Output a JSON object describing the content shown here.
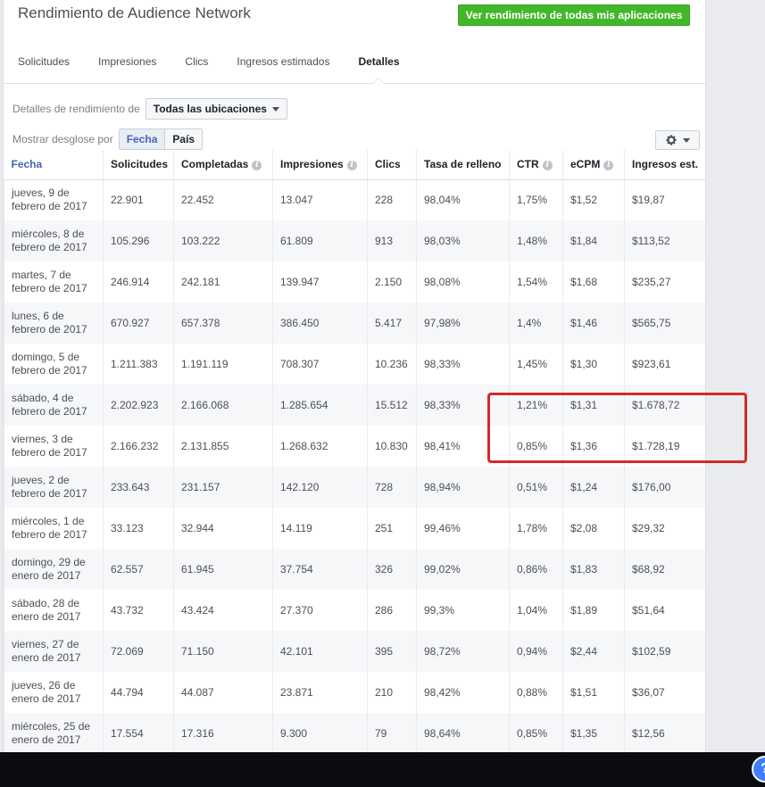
{
  "header": {
    "title": "Rendimiento de Audience Network",
    "all_apps_button": "Ver rendimiento de todas mis aplicaciones"
  },
  "tabs": [
    {
      "label": "Solicitudes"
    },
    {
      "label": "Impresiones"
    },
    {
      "label": "Clics"
    },
    {
      "label": "Ingresos estimados"
    },
    {
      "label": "Detalles"
    }
  ],
  "filters": {
    "detail_label": "Detalles de rendimiento de",
    "placement_value": "Todas las ubicaciones",
    "breakdown_label": "Mostrar desglose por",
    "breakdown_options": [
      "Fecha",
      "País"
    ],
    "breakdown_selected": "Fecha"
  },
  "table": {
    "headers": [
      "Fecha",
      "Solicitudes",
      "Completadas",
      "Impresiones",
      "Clics",
      "Tasa de relleno",
      "CTR",
      "eCPM",
      "Ingresos est."
    ],
    "rows": [
      {
        "date": "jueves, 9 de febrero de 2017",
        "solicitudes": "22.901",
        "completadas": "22.452",
        "impresiones": "13.047",
        "clics": "228",
        "tasa": "98,04%",
        "ctr": "1,75%",
        "ecpm": "$1,52",
        "ingresos": "$19,87"
      },
      {
        "date": "miércoles, 8 de febrero de 2017",
        "solicitudes": "105.296",
        "completadas": "103.222",
        "impresiones": "61.809",
        "clics": "913",
        "tasa": "98,03%",
        "ctr": "1,48%",
        "ecpm": "$1,84",
        "ingresos": "$113,52"
      },
      {
        "date": "martes, 7 de febrero de 2017",
        "solicitudes": "246.914",
        "completadas": "242.181",
        "impresiones": "139.947",
        "clics": "2.150",
        "tasa": "98,08%",
        "ctr": "1,54%",
        "ecpm": "$1,68",
        "ingresos": "$235,27"
      },
      {
        "date": "lunes, 6 de febrero de 2017",
        "solicitudes": "670.927",
        "completadas": "657.378",
        "impresiones": "386.450",
        "clics": "5.417",
        "tasa": "97,98%",
        "ctr": "1,4%",
        "ecpm": "$1,46",
        "ingresos": "$565,75"
      },
      {
        "date": "domingo, 5 de febrero de 2017",
        "solicitudes": "1.211.383",
        "completadas": "1.191.119",
        "impresiones": "708.307",
        "clics": "10.236",
        "tasa": "98,33%",
        "ctr": "1,45%",
        "ecpm": "$1,30",
        "ingresos": "$923,61"
      },
      {
        "date": "sábado, 4 de febrero de 2017",
        "solicitudes": "2.202.923",
        "completadas": "2.166.068",
        "impresiones": "1.285.654",
        "clics": "15.512",
        "tasa": "98,33%",
        "ctr": "1,21%",
        "ecpm": "$1,31",
        "ingresos": "$1.678,72"
      },
      {
        "date": "viernes, 3 de febrero de 2017",
        "solicitudes": "2.166.232",
        "completadas": "2.131.855",
        "impresiones": "1.268.632",
        "clics": "10.830",
        "tasa": "98,41%",
        "ctr": "0,85%",
        "ecpm": "$1,36",
        "ingresos": "$1.728,19"
      },
      {
        "date": "jueves, 2 de febrero de 2017",
        "solicitudes": "233.643",
        "completadas": "231.157",
        "impresiones": "142.120",
        "clics": "728",
        "tasa": "98,94%",
        "ctr": "0,51%",
        "ecpm": "$1,24",
        "ingresos": "$176,00"
      },
      {
        "date": "miércoles, 1 de febrero de 2017",
        "solicitudes": "33.123",
        "completadas": "32.944",
        "impresiones": "14.119",
        "clics": "251",
        "tasa": "99,46%",
        "ctr": "1,78%",
        "ecpm": "$2,08",
        "ingresos": "$29,32"
      },
      {
        "date": "domingo, 29 de enero de 2017",
        "solicitudes": "62.557",
        "completadas": "61.945",
        "impresiones": "37.754",
        "clics": "326",
        "tasa": "99,02%",
        "ctr": "0,86%",
        "ecpm": "$1,83",
        "ingresos": "$68,92"
      },
      {
        "date": "sábado, 28 de enero de 2017",
        "solicitudes": "43.732",
        "completadas": "43.424",
        "impresiones": "27.370",
        "clics": "286",
        "tasa": "99,3%",
        "ctr": "1,04%",
        "ecpm": "$1,89",
        "ingresos": "$51,64"
      },
      {
        "date": "viernes, 27 de enero de 2017",
        "solicitudes": "72.069",
        "completadas": "71.150",
        "impresiones": "42.101",
        "clics": "395",
        "tasa": "98,72%",
        "ctr": "0,94%",
        "ecpm": "$2,44",
        "ingresos": "$102,59"
      },
      {
        "date": "jueves, 26 de enero de 2017",
        "solicitudes": "44.794",
        "completadas": "44.087",
        "impresiones": "23.871",
        "clics": "210",
        "tasa": "98,42%",
        "ctr": "0,88%",
        "ecpm": "$1,51",
        "ingresos": "$36,07"
      },
      {
        "date": "miércoles, 25 de enero de 2017",
        "solicitudes": "17.554",
        "completadas": "17.316",
        "impresiones": "9.300",
        "clics": "79",
        "tasa": "98,64%",
        "ctr": "0,85%",
        "ecpm": "$1,35",
        "ingresos": "$12,56"
      }
    ]
  },
  "icons": {
    "settings": "gear-icon",
    "info": "info-icon",
    "help": "help-icon"
  },
  "colors": {
    "accent_green": "#42b72a",
    "link_blue": "#4267b2",
    "highlight_red": "#d62929"
  },
  "help": {
    "label": "?"
  }
}
